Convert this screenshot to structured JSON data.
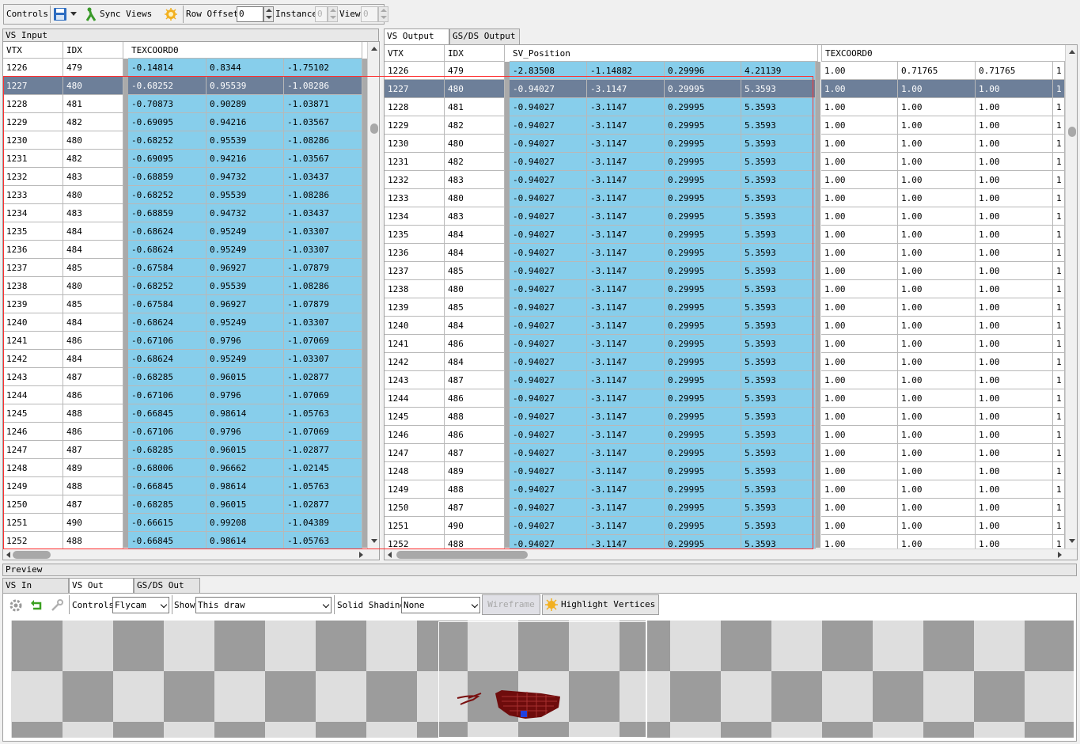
{
  "toolbar": {
    "controls_label": "Controls",
    "sync_views": "Sync Views",
    "row_offset_label": "Row Offset",
    "row_offset_value": "0",
    "instance_label": "Instance",
    "instance_value": "0",
    "view_label": "View",
    "view_value": "0"
  },
  "vs_input": {
    "title": "VS Input",
    "headers": {
      "vtx": "VTX",
      "idx": "IDX",
      "attr": "TEXCOORD0"
    },
    "rows": [
      [
        "1226",
        "479",
        "-0.14814",
        "0.8344",
        "-1.75102"
      ],
      [
        "1227",
        "480",
        "-0.68252",
        "0.95539",
        "-1.08286"
      ],
      [
        "1228",
        "481",
        "-0.70873",
        "0.90289",
        "-1.03871"
      ],
      [
        "1229",
        "482",
        "-0.69095",
        "0.94216",
        "-1.03567"
      ],
      [
        "1230",
        "480",
        "-0.68252",
        "0.95539",
        "-1.08286"
      ],
      [
        "1231",
        "482",
        "-0.69095",
        "0.94216",
        "-1.03567"
      ],
      [
        "1232",
        "483",
        "-0.68859",
        "0.94732",
        "-1.03437"
      ],
      [
        "1233",
        "480",
        "-0.68252",
        "0.95539",
        "-1.08286"
      ],
      [
        "1234",
        "483",
        "-0.68859",
        "0.94732",
        "-1.03437"
      ],
      [
        "1235",
        "484",
        "-0.68624",
        "0.95249",
        "-1.03307"
      ],
      [
        "1236",
        "484",
        "-0.68624",
        "0.95249",
        "-1.03307"
      ],
      [
        "1237",
        "485",
        "-0.67584",
        "0.96927",
        "-1.07879"
      ],
      [
        "1238",
        "480",
        "-0.68252",
        "0.95539",
        "-1.08286"
      ],
      [
        "1239",
        "485",
        "-0.67584",
        "0.96927",
        "-1.07879"
      ],
      [
        "1240",
        "484",
        "-0.68624",
        "0.95249",
        "-1.03307"
      ],
      [
        "1241",
        "486",
        "-0.67106",
        "0.9796",
        "-1.07069"
      ],
      [
        "1242",
        "484",
        "-0.68624",
        "0.95249",
        "-1.03307"
      ],
      [
        "1243",
        "487",
        "-0.68285",
        "0.96015",
        "-1.02877"
      ],
      [
        "1244",
        "486",
        "-0.67106",
        "0.9796",
        "-1.07069"
      ],
      [
        "1245",
        "488",
        "-0.66845",
        "0.98614",
        "-1.05763"
      ],
      [
        "1246",
        "486",
        "-0.67106",
        "0.9796",
        "-1.07069"
      ],
      [
        "1247",
        "487",
        "-0.68285",
        "0.96015",
        "-1.02877"
      ],
      [
        "1248",
        "489",
        "-0.68006",
        "0.96662",
        "-1.02145"
      ],
      [
        "1249",
        "488",
        "-0.66845",
        "0.98614",
        "-1.05763"
      ],
      [
        "1250",
        "487",
        "-0.68285",
        "0.96015",
        "-1.02877"
      ],
      [
        "1251",
        "490",
        "-0.66615",
        "0.99208",
        "-1.04389"
      ],
      [
        "1252",
        "488",
        "-0.66845",
        "0.98614",
        "-1.05763"
      ]
    ]
  },
  "vs_output": {
    "tabs": [
      "VS Output",
      "GS/DS Output"
    ],
    "headers": {
      "vtx": "VTX",
      "idx": "IDX",
      "pos": "SV_Position",
      "tex": "TEXCOORD0"
    },
    "rows": [
      [
        "1226",
        "479",
        "-2.83508",
        "-1.14882",
        "0.29996",
        "4.21139",
        "1.00",
        "0.71765",
        "0.71765",
        "1"
      ],
      [
        "1227",
        "480",
        "-0.94027",
        "-3.1147",
        "0.29995",
        "5.3593",
        "1.00",
        "1.00",
        "1.00",
        "1"
      ],
      [
        "1228",
        "481",
        "-0.94027",
        "-3.1147",
        "0.29995",
        "5.3593",
        "1.00",
        "1.00",
        "1.00",
        "1"
      ],
      [
        "1229",
        "482",
        "-0.94027",
        "-3.1147",
        "0.29995",
        "5.3593",
        "1.00",
        "1.00",
        "1.00",
        "1"
      ],
      [
        "1230",
        "480",
        "-0.94027",
        "-3.1147",
        "0.29995",
        "5.3593",
        "1.00",
        "1.00",
        "1.00",
        "1"
      ],
      [
        "1231",
        "482",
        "-0.94027",
        "-3.1147",
        "0.29995",
        "5.3593",
        "1.00",
        "1.00",
        "1.00",
        "1"
      ],
      [
        "1232",
        "483",
        "-0.94027",
        "-3.1147",
        "0.29995",
        "5.3593",
        "1.00",
        "1.00",
        "1.00",
        "1"
      ],
      [
        "1233",
        "480",
        "-0.94027",
        "-3.1147",
        "0.29995",
        "5.3593",
        "1.00",
        "1.00",
        "1.00",
        "1"
      ],
      [
        "1234",
        "483",
        "-0.94027",
        "-3.1147",
        "0.29995",
        "5.3593",
        "1.00",
        "1.00",
        "1.00",
        "1"
      ],
      [
        "1235",
        "484",
        "-0.94027",
        "-3.1147",
        "0.29995",
        "5.3593",
        "1.00",
        "1.00",
        "1.00",
        "1"
      ],
      [
        "1236",
        "484",
        "-0.94027",
        "-3.1147",
        "0.29995",
        "5.3593",
        "1.00",
        "1.00",
        "1.00",
        "1"
      ],
      [
        "1237",
        "485",
        "-0.94027",
        "-3.1147",
        "0.29995",
        "5.3593",
        "1.00",
        "1.00",
        "1.00",
        "1"
      ],
      [
        "1238",
        "480",
        "-0.94027",
        "-3.1147",
        "0.29995",
        "5.3593",
        "1.00",
        "1.00",
        "1.00",
        "1"
      ],
      [
        "1239",
        "485",
        "-0.94027",
        "-3.1147",
        "0.29995",
        "5.3593",
        "1.00",
        "1.00",
        "1.00",
        "1"
      ],
      [
        "1240",
        "484",
        "-0.94027",
        "-3.1147",
        "0.29995",
        "5.3593",
        "1.00",
        "1.00",
        "1.00",
        "1"
      ],
      [
        "1241",
        "486",
        "-0.94027",
        "-3.1147",
        "0.29995",
        "5.3593",
        "1.00",
        "1.00",
        "1.00",
        "1"
      ],
      [
        "1242",
        "484",
        "-0.94027",
        "-3.1147",
        "0.29995",
        "5.3593",
        "1.00",
        "1.00",
        "1.00",
        "1"
      ],
      [
        "1243",
        "487",
        "-0.94027",
        "-3.1147",
        "0.29995",
        "5.3593",
        "1.00",
        "1.00",
        "1.00",
        "1"
      ],
      [
        "1244",
        "486",
        "-0.94027",
        "-3.1147",
        "0.29995",
        "5.3593",
        "1.00",
        "1.00",
        "1.00",
        "1"
      ],
      [
        "1245",
        "488",
        "-0.94027",
        "-3.1147",
        "0.29995",
        "5.3593",
        "1.00",
        "1.00",
        "1.00",
        "1"
      ],
      [
        "1246",
        "486",
        "-0.94027",
        "-3.1147",
        "0.29995",
        "5.3593",
        "1.00",
        "1.00",
        "1.00",
        "1"
      ],
      [
        "1247",
        "487",
        "-0.94027",
        "-3.1147",
        "0.29995",
        "5.3593",
        "1.00",
        "1.00",
        "1.00",
        "1"
      ],
      [
        "1248",
        "489",
        "-0.94027",
        "-3.1147",
        "0.29995",
        "5.3593",
        "1.00",
        "1.00",
        "1.00",
        "1"
      ],
      [
        "1249",
        "488",
        "-0.94027",
        "-3.1147",
        "0.29995",
        "5.3593",
        "1.00",
        "1.00",
        "1.00",
        "1"
      ],
      [
        "1250",
        "487",
        "-0.94027",
        "-3.1147",
        "0.29995",
        "5.3593",
        "1.00",
        "1.00",
        "1.00",
        "1"
      ],
      [
        "1251",
        "490",
        "-0.94027",
        "-3.1147",
        "0.29995",
        "5.3593",
        "1.00",
        "1.00",
        "1.00",
        "1"
      ],
      [
        "1252",
        "488",
        "-0.94027",
        "-3.1147",
        "0.29995",
        "5.3593",
        "1.00",
        "1.00",
        "1.00",
        "1"
      ]
    ]
  },
  "preview": {
    "title": "Preview",
    "tabs": [
      "VS In",
      "VS Out",
      "GS/DS Out"
    ],
    "controls_label": "Controls",
    "controls_value": "Flycam",
    "show_label": "Show",
    "show_value": "This draw",
    "solid_shading_label": "Solid Shading",
    "solid_shading_value": "None",
    "wireframe_label": "Wireframe",
    "highlight_vertices_label": "Highlight Vertices"
  },
  "colors": {
    "data_cell": "#87ceeb",
    "selected_row": "#6d7f99",
    "selection_box": "#ff3030",
    "checker_dark": "#9c9c9c",
    "checker_light": "#dedede",
    "mesh": "#7a1010"
  },
  "selected_row_index": 1
}
